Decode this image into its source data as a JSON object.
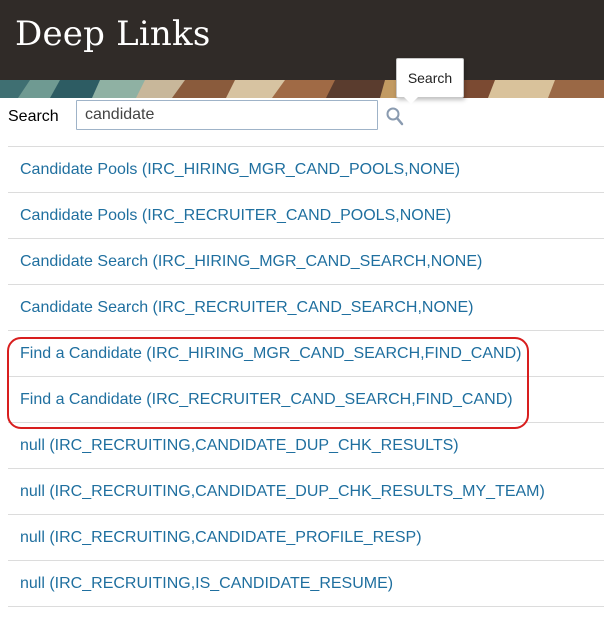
{
  "header": {
    "title": "Deep Links"
  },
  "search": {
    "label": "Search",
    "value": "candidate",
    "tooltip": "Search"
  },
  "results": [
    {
      "label": "Candidate Pools (IRC_HIRING_MGR_CAND_POOLS,NONE)"
    },
    {
      "label": "Candidate Pools (IRC_RECRUITER_CAND_POOLS,NONE)"
    },
    {
      "label": "Candidate Search (IRC_HIRING_MGR_CAND_SEARCH,NONE)"
    },
    {
      "label": "Candidate Search (IRC_RECRUITER_CAND_SEARCH,NONE)"
    },
    {
      "label": "Find a Candidate (IRC_HIRING_MGR_CAND_SEARCH,FIND_CAND)"
    },
    {
      "label": "Find a Candidate (IRC_RECRUITER_CAND_SEARCH,FIND_CAND)"
    },
    {
      "label": "null (IRC_RECRUITING,CANDIDATE_DUP_CHK_RESULTS)"
    },
    {
      "label": "null (IRC_RECRUITING,CANDIDATE_DUP_CHK_RESULTS_MY_TEAM)"
    },
    {
      "label": "null (IRC_RECRUITING,CANDIDATE_PROFILE_RESP)"
    },
    {
      "label": "null (IRC_RECRUITING,IS_CANDIDATE_RESUME)"
    }
  ],
  "colors": {
    "header_bg": "#302b28",
    "link": "#1f6f9f",
    "highlight": "#d81e1e"
  },
  "icons": {
    "search": "magnifier-icon"
  }
}
